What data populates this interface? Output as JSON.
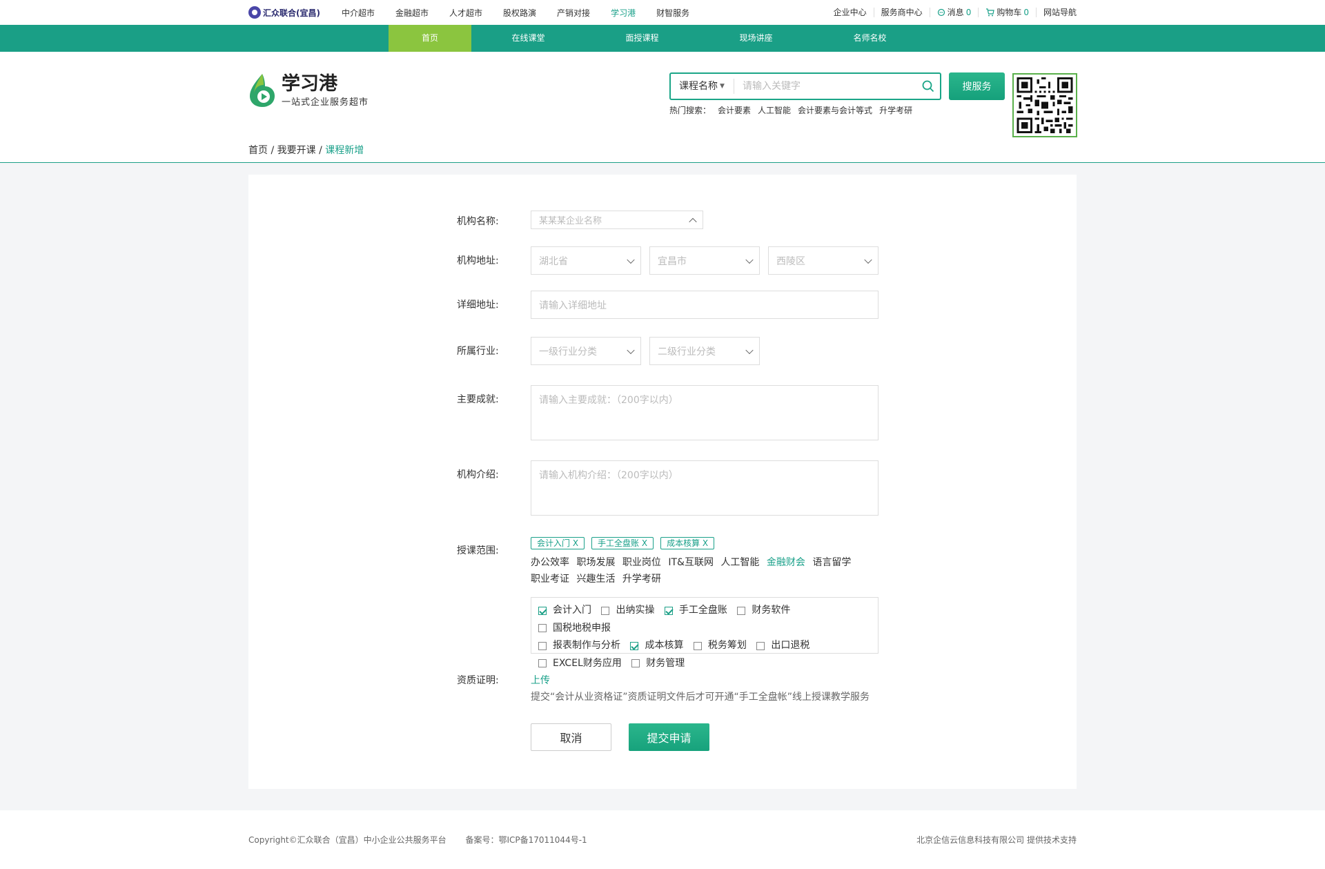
{
  "topbar": {
    "brand": "汇众联合(宜昌)",
    "nav": [
      "中介超市",
      "金融超市",
      "人才超市",
      "股权路演",
      "产销对接",
      "学习港",
      "财智服务"
    ],
    "active_nav": "学习港",
    "right": {
      "enterprise": "企业中心",
      "service": "服务商中心",
      "messages_label": "消息",
      "messages_count": "0",
      "cart_label": "购物车",
      "cart_count": "0",
      "sitemap": "网站导航"
    }
  },
  "green_nav": {
    "items": [
      "首页",
      "在线课堂",
      "面授课程",
      "现场讲座",
      "名师名校"
    ],
    "active": "首页"
  },
  "logo": {
    "title": "学习港",
    "subtitle": "一站式企业服务超市"
  },
  "search": {
    "category": "课程名称",
    "placeholder": "请输入关键字",
    "button": "搜服务",
    "hot_label": "热门搜索：",
    "hot_terms": [
      "会计要素",
      "人工智能",
      "会计要素与会计等式",
      "升学考研"
    ]
  },
  "breadcrumb": {
    "home": "首页",
    "sep": "/",
    "parent": "我要开课",
    "current": "课程新增"
  },
  "form": {
    "org_name": {
      "label": "机构名称:",
      "placeholder": "某某某企业名称"
    },
    "org_address": {
      "label": "机构地址:",
      "province": "湖北省",
      "city": "宜昌市",
      "district": "西陵区"
    },
    "detail_address": {
      "label": "详细地址:",
      "placeholder": "请输入详细地址"
    },
    "industry": {
      "label": "所属行业:",
      "level1": "一级行业分类",
      "level2": "二级行业分类"
    },
    "achievements": {
      "label": "主要成就:",
      "placeholder": "请输入主要成就：（200字以内）"
    },
    "intro": {
      "label": "机构介绍:",
      "placeholder": "请输入机构介绍：（200字以内）"
    },
    "scope": {
      "label": "授课范围:",
      "selected_tags": [
        "会计入门 X",
        "手工全盘账 X",
        "成本核算 X"
      ],
      "categories_row1": [
        "办公效率",
        "职场发展",
        "职业岗位",
        "IT&互联网",
        "人工智能",
        "金融财会",
        "语言留学"
      ],
      "categories_row2": [
        "职业考证",
        "兴趣生活",
        "升学考研"
      ],
      "active_category": "金融财会",
      "checkboxes": [
        {
          "label": "会计入门",
          "checked": true
        },
        {
          "label": "出纳实操",
          "checked": false
        },
        {
          "label": "手工全盘账",
          "checked": true
        },
        {
          "label": "财务软件",
          "checked": false
        },
        {
          "label": "国税地税申报",
          "checked": false
        },
        {
          "label": "报表制作与分析",
          "checked": false
        },
        {
          "label": "成本核算",
          "checked": true
        },
        {
          "label": "税务筹划",
          "checked": false
        },
        {
          "label": "出口退税",
          "checked": false
        },
        {
          "label": "EXCEL财务应用",
          "checked": false
        },
        {
          "label": "财务管理",
          "checked": false
        }
      ]
    },
    "qualification": {
      "label": "资质证明:",
      "upload": "上传",
      "hint": "提交“会计从业资格证”资质证明文件后才可开通“手工全盘帐”线上授课教学服务"
    },
    "cancel": "取消",
    "submit": "提交申请"
  },
  "footer": {
    "copyright": "Copyright©汇众联合（宜昌）中小企业公共服务平台",
    "icp": "备案号：鄂ICP备17011044号-1",
    "support": "北京企信云信息科技有限公司 提供技术支持"
  },
  "colors": {
    "primary": "#1a9f86",
    "accent": "#8bc53f",
    "text": "#333333"
  }
}
